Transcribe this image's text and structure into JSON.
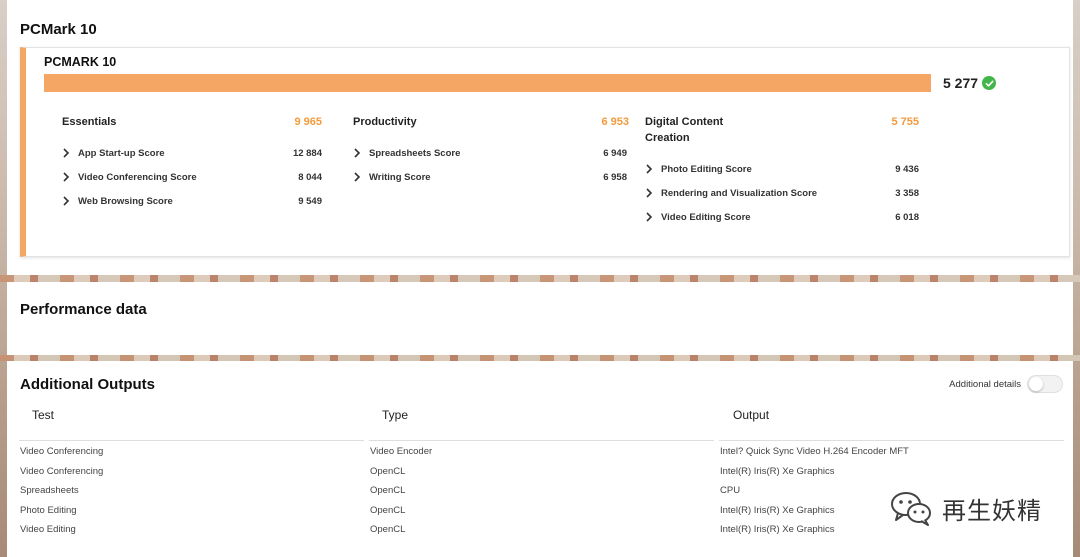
{
  "pcmark_panel": {
    "title": "PCMark 10",
    "card_title": "PCMARK 10",
    "total_score": "5 277",
    "bar_fill_fraction": 1.0,
    "accent_color": "#f5a564",
    "check_color": "#43b649",
    "groups": [
      {
        "name": "Essentials",
        "score": "9 965",
        "items": [
          {
            "label": "App Start-up Score",
            "value": "12 884"
          },
          {
            "label": "Video Conferencing Score",
            "value": "8 044"
          },
          {
            "label": "Web Browsing Score",
            "value": "9 549"
          }
        ]
      },
      {
        "name": "Productivity",
        "score": "6 953",
        "items": [
          {
            "label": "Spreadsheets Score",
            "value": "6 949"
          },
          {
            "label": "Writing Score",
            "value": "6 958"
          }
        ]
      },
      {
        "name": "Digital Content Creation",
        "score": "5 755",
        "items": [
          {
            "label": "Photo Editing Score",
            "value": "9 436"
          },
          {
            "label": "Rendering and Visualization Score",
            "value": "3 358"
          },
          {
            "label": "Video Editing Score",
            "value": "6 018"
          }
        ]
      }
    ]
  },
  "performance_panel": {
    "title": "Performance data"
  },
  "outputs_panel": {
    "title": "Additional Outputs",
    "details_label": "Additional details",
    "details_enabled": false,
    "columns": [
      "Test",
      "Type",
      "Output"
    ],
    "rows": [
      [
        "Video Conferencing",
        "Video Encoder",
        "Intel? Quick Sync Video H.264 Encoder MFT"
      ],
      [
        "Video Conferencing",
        "OpenCL",
        "Intel(R) Iris(R) Xe Graphics"
      ],
      [
        "Spreadsheets",
        "OpenCL",
        "CPU"
      ],
      [
        "Photo Editing",
        "OpenCL",
        "Intel(R) Iris(R) Xe Graphics"
      ],
      [
        "Video Editing",
        "OpenCL",
        "Intel(R) Iris(R) Xe Graphics"
      ]
    ]
  },
  "watermark": {
    "text": "再生妖精",
    "icon": "wechat-icon"
  }
}
